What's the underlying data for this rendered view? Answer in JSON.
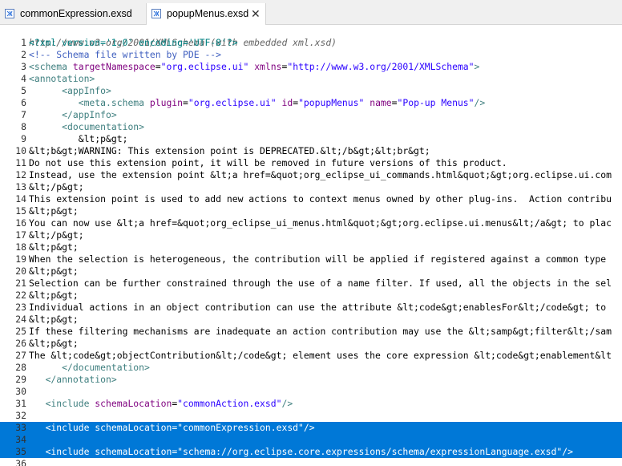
{
  "tabs": [
    {
      "label": "commonExpression.exsd",
      "active": false
    },
    {
      "label": "popupMenus.exsd",
      "active": true
    }
  ],
  "close_glyph": "✕",
  "schema_hint": "http://www.w3.org/2001/XMLSchema (with embedded xml.xsd)",
  "colors": {
    "selection": "#0078d7",
    "tag": "#3f7f7f",
    "attr_value": "#2a00ff",
    "attr_name": "#7f007f",
    "comment": "#3f5fbf"
  },
  "lines": [
    {
      "n": "1",
      "segs": [
        [
          "<?xml version='1.0' encoding='UTF-8'?>",
          "pi"
        ]
      ]
    },
    {
      "n": "2",
      "segs": [
        [
          "<!-- Schema file written by PDE -->",
          "comment"
        ]
      ]
    },
    {
      "n": "3",
      "segs": [
        [
          "<schema ",
          "teal"
        ],
        [
          "targetNamespace",
          "purple"
        ],
        [
          "=",
          "text"
        ],
        [
          "\"org.eclipse.ui\"",
          "blue"
        ],
        [
          " xmlns",
          "purple"
        ],
        [
          "=",
          "text"
        ],
        [
          "\"http://www.w3.org/2001/XMLSchema\"",
          "blue"
        ],
        [
          ">",
          "teal"
        ]
      ]
    },
    {
      "n": "4",
      "segs": [
        [
          "<annotation>",
          "teal"
        ]
      ]
    },
    {
      "n": "5",
      "segs": [
        [
          "      <appInfo>",
          "teal"
        ]
      ]
    },
    {
      "n": "6",
      "segs": [
        [
          "         <meta.schema ",
          "teal"
        ],
        [
          "plugin",
          "purple"
        ],
        [
          "=",
          "text"
        ],
        [
          "\"org.eclipse.ui\"",
          "blue"
        ],
        [
          " id",
          "purple"
        ],
        [
          "=",
          "text"
        ],
        [
          "\"popupMenus\"",
          "blue"
        ],
        [
          " name",
          "purple"
        ],
        [
          "=",
          "text"
        ],
        [
          "\"Pop-up Menus\"",
          "blue"
        ],
        [
          "/>",
          "teal"
        ]
      ]
    },
    {
      "n": "7",
      "segs": [
        [
          "      </appInfo>",
          "teal"
        ]
      ]
    },
    {
      "n": "8",
      "segs": [
        [
          "      <documentation>",
          "teal"
        ]
      ]
    },
    {
      "n": "9",
      "segs": [
        [
          "         &lt;p&gt;",
          "text"
        ]
      ]
    },
    {
      "n": "10",
      "segs": [
        [
          "&lt;b&gt;WARNING: This extension point is DEPRECATED.&lt;/b&gt;&lt;br&gt;",
          "text"
        ]
      ]
    },
    {
      "n": "11",
      "segs": [
        [
          "Do not use this extension point, it will be removed in future versions of this product.",
          "text"
        ]
      ]
    },
    {
      "n": "12",
      "segs": [
        [
          "Instead, use the extension point &lt;a href=&quot;org_eclipse_ui_commands.html&quot;&gt;org.eclipse.ui.com",
          "text"
        ]
      ]
    },
    {
      "n": "13",
      "segs": [
        [
          "&lt;/p&gt;",
          "text"
        ]
      ]
    },
    {
      "n": "14",
      "segs": [
        [
          "This extension point is used to add new actions to context menus owned by other plug-ins.  Action contribu",
          "text"
        ]
      ]
    },
    {
      "n": "15",
      "segs": [
        [
          "&lt;p&gt;",
          "text"
        ]
      ]
    },
    {
      "n": "16",
      "segs": [
        [
          "You can now use &lt;a href=&quot;org_eclipse_ui_menus.html&quot;&gt;org.eclipse.ui.menus&lt;/a&gt; to plac",
          "text"
        ]
      ]
    },
    {
      "n": "17",
      "segs": [
        [
          "&lt;/p&gt;",
          "text"
        ]
      ]
    },
    {
      "n": "18",
      "segs": [
        [
          "&lt;p&gt;",
          "text"
        ]
      ]
    },
    {
      "n": "19",
      "segs": [
        [
          "When the selection is heterogeneous, the contribution will be applied if registered against a common type",
          "text"
        ]
      ]
    },
    {
      "n": "20",
      "segs": [
        [
          "&lt;p&gt;",
          "text"
        ]
      ]
    },
    {
      "n": "21",
      "segs": [
        [
          "Selection can be further constrained through the use of a name filter. If used, all the objects in the sel",
          "text"
        ]
      ]
    },
    {
      "n": "22",
      "segs": [
        [
          "&lt;p&gt;",
          "text"
        ]
      ]
    },
    {
      "n": "23",
      "segs": [
        [
          "Individual actions in an object contribution can use the attribute &lt;code&gt;enablesFor&lt;/code&gt; to",
          "text"
        ]
      ]
    },
    {
      "n": "24",
      "segs": [
        [
          "&lt;p&gt;",
          "text"
        ]
      ]
    },
    {
      "n": "25",
      "segs": [
        [
          "If these filtering mechanisms are inadequate an action contribution may use the &lt;samp&gt;filter&lt;/sam",
          "text"
        ]
      ]
    },
    {
      "n": "26",
      "segs": [
        [
          "&lt;p&gt;",
          "text"
        ]
      ]
    },
    {
      "n": "27",
      "segs": [
        [
          "The &lt;code&gt;objectContribution&lt;/code&gt; element uses the core expression &lt;code&gt;enablement&lt",
          "text"
        ]
      ]
    },
    {
      "n": "28",
      "segs": [
        [
          "      </documentation>",
          "teal"
        ]
      ]
    },
    {
      "n": "29",
      "segs": [
        [
          "   </annotation>",
          "teal"
        ]
      ]
    },
    {
      "n": "30",
      "segs": []
    },
    {
      "n": "31",
      "segs": [
        [
          "   <include ",
          "teal"
        ],
        [
          "schemaLocation",
          "purple"
        ],
        [
          "=",
          "text"
        ],
        [
          "\"commonAction.exsd\"",
          "blue"
        ],
        [
          "/>",
          "teal"
        ]
      ]
    },
    {
      "n": "32",
      "segs": []
    },
    {
      "n": "33",
      "hl": true,
      "segs": [
        [
          "   <include ",
          "teal"
        ],
        [
          "schemaLocation",
          "purple"
        ],
        [
          "=",
          "text"
        ],
        [
          "\"commonExpression.exsd\"",
          "blue"
        ],
        [
          "/>",
          "teal"
        ]
      ]
    },
    {
      "n": "34",
      "hl": true,
      "segs": []
    },
    {
      "n": "35",
      "hl": true,
      "segs": [
        [
          "   <include ",
          "teal"
        ],
        [
          "schemaLocation",
          "purple"
        ],
        [
          "=",
          "text"
        ],
        [
          "\"schema://org.eclipse.core.expressions/schema/expressionLanguage.exsd\"",
          "blue"
        ],
        [
          "/>",
          "teal"
        ]
      ]
    },
    {
      "n": "36",
      "segs": []
    }
  ]
}
